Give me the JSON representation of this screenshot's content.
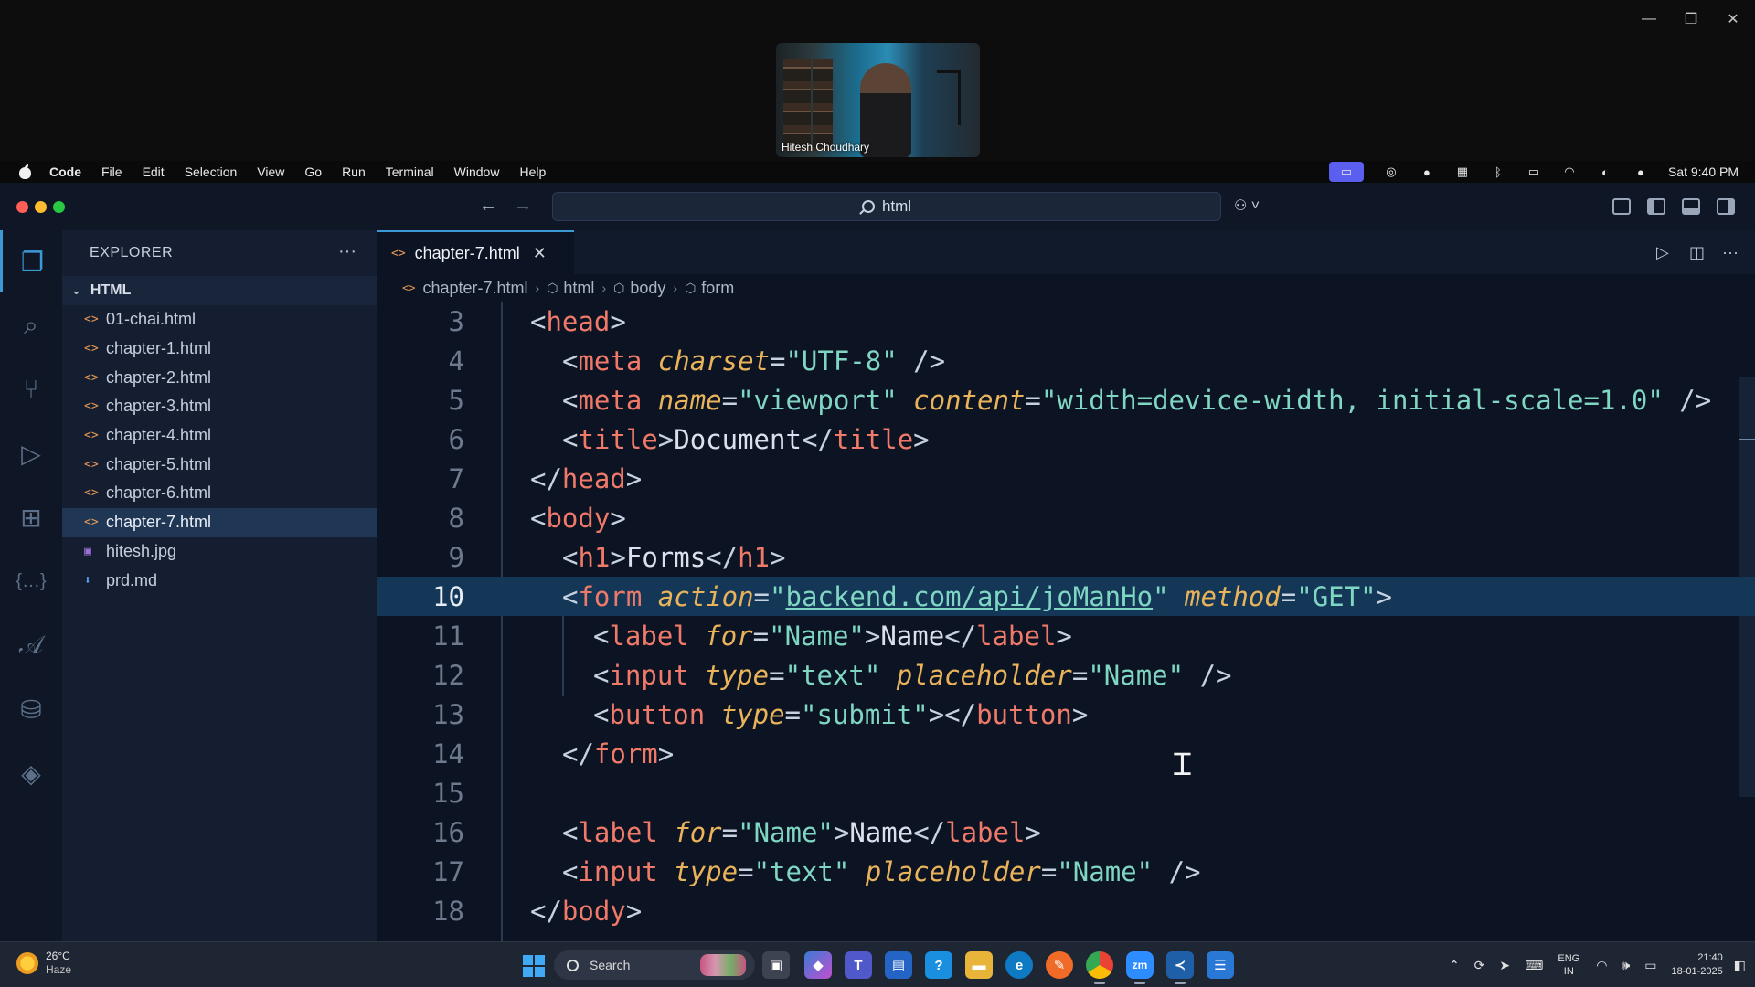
{
  "meeting": {
    "participant_name": "Hitesh Choudhary"
  },
  "menubar": {
    "items": [
      "Code",
      "File",
      "Edit",
      "Selection",
      "View",
      "Go",
      "Run",
      "Terminal",
      "Window",
      "Help"
    ],
    "clock": "Sat 9:40 PM"
  },
  "titlebar": {
    "search_text": "html"
  },
  "sidebar": {
    "header": "EXPLORER",
    "more": "···",
    "folder": "HTML",
    "files": [
      {
        "name": "01-chai.html",
        "icon": "html-file-icon"
      },
      {
        "name": "chapter-1.html",
        "icon": "html-file-icon"
      },
      {
        "name": "chapter-2.html",
        "icon": "html-file-icon"
      },
      {
        "name": "chapter-3.html",
        "icon": "html-file-icon"
      },
      {
        "name": "chapter-4.html",
        "icon": "html-file-icon"
      },
      {
        "name": "chapter-5.html",
        "icon": "html-file-icon"
      },
      {
        "name": "chapter-6.html",
        "icon": "html-file-icon"
      },
      {
        "name": "chapter-7.html",
        "icon": "html-file-icon",
        "selected": true
      },
      {
        "name": "hitesh.jpg",
        "icon": "image-file-icon"
      },
      {
        "name": "prd.md",
        "icon": "markdown-file-icon"
      }
    ]
  },
  "editor": {
    "tab": {
      "label": "chapter-7.html",
      "close": "✕"
    },
    "breadcrumb": [
      "chapter-7.html",
      "html",
      "body",
      "form"
    ],
    "current_line": 10,
    "lines": [
      {
        "n": "3"
      },
      {
        "n": "4"
      },
      {
        "n": "5"
      },
      {
        "n": "6"
      },
      {
        "n": "7"
      },
      {
        "n": "8"
      },
      {
        "n": "9"
      },
      {
        "n": "10"
      },
      {
        "n": "11"
      },
      {
        "n": "12"
      },
      {
        "n": "13"
      },
      {
        "n": "14"
      },
      {
        "n": "15"
      },
      {
        "n": "16"
      },
      {
        "n": "17"
      },
      {
        "n": "18"
      }
    ],
    "code": {
      "l3_tag": "head",
      "l4_tag": "meta",
      "l4_attr": "charset",
      "l4_val": "\"UTF-8\"",
      "l5_tag": "meta",
      "l5_attr1": "name",
      "l5_val1": "\"viewport\"",
      "l5_attr2": "content",
      "l5_val2": "\"width=device-width, initial-scale=1.0\"",
      "l6_tag": "title",
      "l6_text": "Document",
      "l7_tag": "head",
      "l8_tag": "body",
      "l9_tag": "h1",
      "l9_text": "Forms",
      "l10_tag": "form",
      "l10_attr1": "action",
      "l10_val1_q": "\"",
      "l10_val1": "backend.com/api/joManHo",
      "l10_attr2": "method",
      "l10_val2": "\"GET\"",
      "l11_tag": "label",
      "l11_attr": "for",
      "l11_val": "\"Name\"",
      "l11_text": "Name",
      "l12_tag": "input",
      "l12_attr1": "type",
      "l12_val1": "\"text\"",
      "l12_attr2": "placeholder",
      "l12_val2": "\"Name\"",
      "l13_tag": "button",
      "l13_attr": "type",
      "l13_val": "\"submit\"",
      "l14_tag": "form",
      "l16_tag": "label",
      "l16_attr": "for",
      "l16_val": "\"Name\"",
      "l16_text": "Name",
      "l17_tag": "input",
      "l17_attr1": "type",
      "l17_val1": "\"text\"",
      "l17_attr2": "placeholder",
      "l17_val2": "\"Name\"",
      "l18_tag": "body"
    }
  },
  "taskbar": {
    "weather_temp": "26°C",
    "weather_desc": "Haze",
    "search_placeholder": "Search",
    "lang_1": "ENG",
    "lang_2": "IN",
    "time": "21:40",
    "date": "18-01-2025"
  },
  "colors": {
    "accent": "#3b99d6",
    "tag": "#f07a69",
    "attribute": "#e8b35a",
    "string": "#7fd6c2"
  }
}
